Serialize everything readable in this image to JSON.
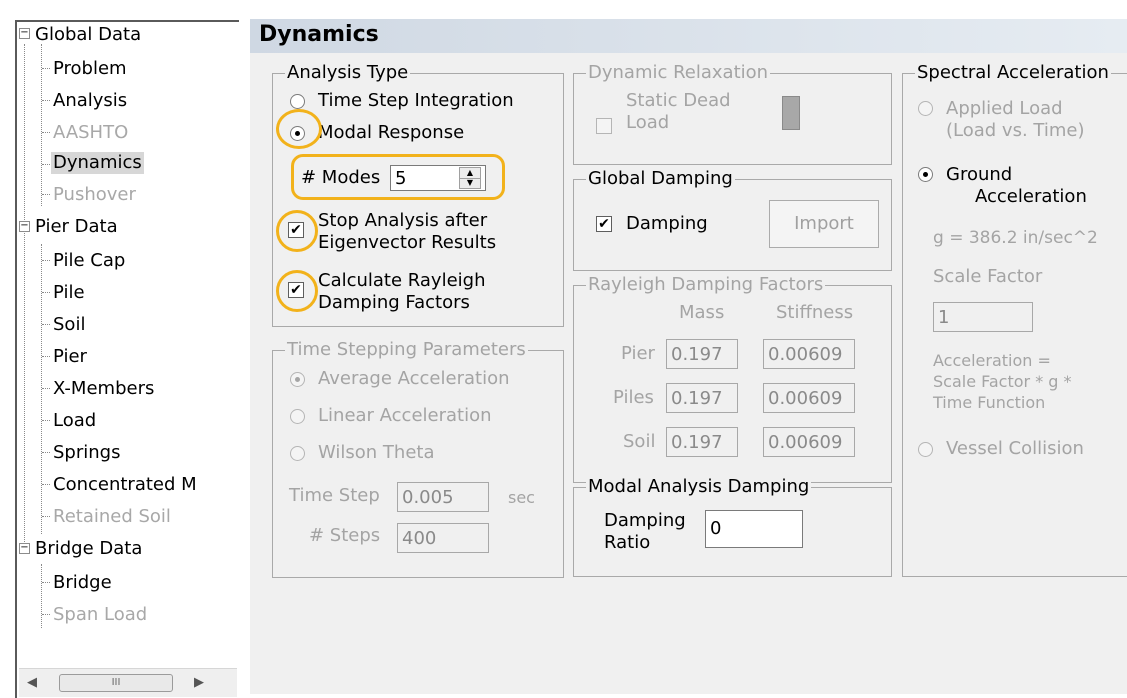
{
  "tree": {
    "global_data": "Global Data",
    "global_children": [
      "Problem",
      "Analysis",
      "AASHTO",
      "Dynamics",
      "Pushover"
    ],
    "pier_data": "Pier Data",
    "pier_children": [
      "Pile Cap",
      "Pile",
      "Soil",
      "Pier",
      "X-Members",
      "Load",
      "Springs",
      "Concentrated M",
      "Retained Soil"
    ],
    "bridge_data": "Bridge Data",
    "bridge_children": [
      "Bridge",
      "Span Load"
    ],
    "scroll_thumb": "III"
  },
  "page": {
    "title": "Dynamics"
  },
  "analysis_type": {
    "caption": "Analysis Type",
    "time_step": "Time Step Integration",
    "modal_response": "Modal Response",
    "modes_label": "# Modes",
    "modes_value": "5",
    "stop_analysis_1": "Stop Analysis after",
    "stop_analysis_2": "Eigenvector Results",
    "rayleigh_1": "Calculate Rayleigh",
    "rayleigh_2": "Damping Factors",
    "check_mark": "✔"
  },
  "time_stepping": {
    "caption": "Time Stepping Parameters",
    "average": "Average Acceleration",
    "linear": "Linear Acceleration",
    "wilson": "Wilson Theta",
    "time_step_label": "Time Step",
    "time_step_value": "0.005",
    "unit": "sec",
    "steps_label": "# Steps",
    "steps_value": "400"
  },
  "dynamic_relaxation": {
    "caption": "Dynamic Relaxation",
    "static_1": "Static Dead",
    "static_2": "Load"
  },
  "global_damping": {
    "caption": "Global Damping",
    "damping": "Damping",
    "import": "Import"
  },
  "rayleigh_factors": {
    "caption": "Rayleigh Damping Factors",
    "mass": "Mass",
    "stiffness": "Stiffness",
    "rows": [
      {
        "label": "Pier",
        "mass": "0.197",
        "stiffness": "0.00609"
      },
      {
        "label": "Piles",
        "mass": "0.197",
        "stiffness": "0.00609"
      },
      {
        "label": "Soil",
        "mass": "0.197",
        "stiffness": "0.00609"
      }
    ]
  },
  "modal_damping": {
    "caption": "Modal Analysis Damping",
    "label_1": "Damping",
    "label_2": "Ratio",
    "value": "0"
  },
  "spectral": {
    "caption": "Spectral Acceleration",
    "applied_1": "Applied Load",
    "applied_2": "(Load vs. Time)",
    "ground_1": "Ground",
    "ground_2": "Acceleration",
    "g_value": "g = 386.2 in/sec^2",
    "scale_label": "Scale Factor",
    "scale_value": "1",
    "accel_1": "Acceleration =",
    "accel_2": "Scale Factor * g *",
    "accel_3": "Time Function",
    "vessel": "Vessel Collision"
  },
  "colors": {
    "highlight": "#f2b21b",
    "header_bg": "#cfd8e3",
    "panel_bg": "#f0f0f0"
  }
}
